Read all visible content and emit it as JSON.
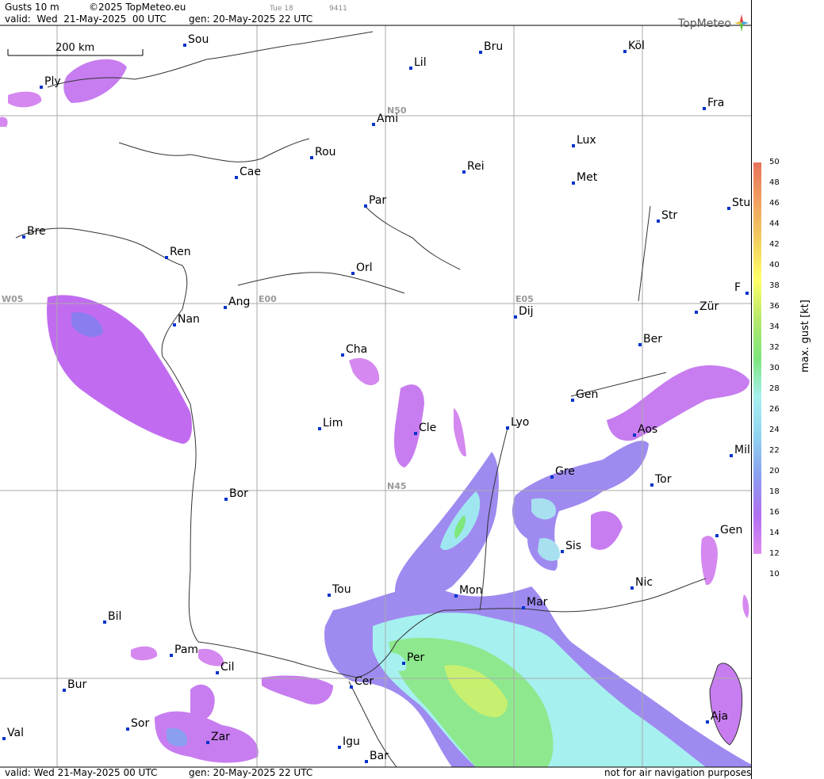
{
  "header": {
    "product": "Gusts 10 m",
    "copyright": "©2025 TopMeteo.eu",
    "day": "Tue 18",
    "code": "9411",
    "valid": "valid:  Wed  21-May-2025  00 UTC",
    "gen": "gen: 20-May-2025 22 UTC",
    "logo": "TopMeteo"
  },
  "footer": {
    "valid": "valid:  Wed  21-May-2025  00 UTC",
    "gen": "gen: 20-May-2025 22 UTC",
    "note": "not for air navigation purposes"
  },
  "scale_bar": {
    "label": "200 km"
  },
  "grid_labels": [
    "N50",
    "N45",
    "W05",
    "E00",
    "E05"
  ],
  "cities": [
    "Sou",
    "Ply",
    "Bru",
    "Köl",
    "Lil",
    "Ami",
    "Fra",
    "Lux",
    "Rou",
    "Cae",
    "Rei",
    "Met",
    "Par",
    "Stu",
    "Bre",
    "Str",
    "Ren",
    "Orl",
    "F",
    "W05",
    "Ang",
    "Nan",
    "Dij",
    "Zür",
    "Ber",
    "Cha",
    "Gen",
    "Lim",
    "Cle",
    "Lyo",
    "Aos",
    "Mil",
    "Gre",
    "Tor",
    "Bor",
    "Sis",
    "Gen",
    "Nic",
    "Tou",
    "Mon",
    "Mar",
    "Bil",
    "Pam",
    "Cil",
    "Per",
    "Bur",
    "Cer",
    "Sor",
    "Aja",
    "Val",
    "Zar",
    "Igu",
    "Bar"
  ],
  "legend": {
    "title": "max. gust [kt]",
    "ticks": [
      "50",
      "48",
      "46",
      "44",
      "42",
      "40",
      "38",
      "36",
      "34",
      "32",
      "30",
      "28",
      "26",
      "24",
      "22",
      "20",
      "18",
      "16",
      "14",
      "12",
      "10"
    ],
    "colors": {
      "c50": "#e8735a",
      "c46": "#f0a060",
      "c42": "#f3cf5f",
      "c38": "#ffff66",
      "c34": "#b5e86a",
      "c30": "#7de67d",
      "c28": "#a6f0f0",
      "c24": "#8fd3f0",
      "c20": "#8a9ff0",
      "c16": "#b070f0",
      "c12": "#e08af0"
    }
  }
}
